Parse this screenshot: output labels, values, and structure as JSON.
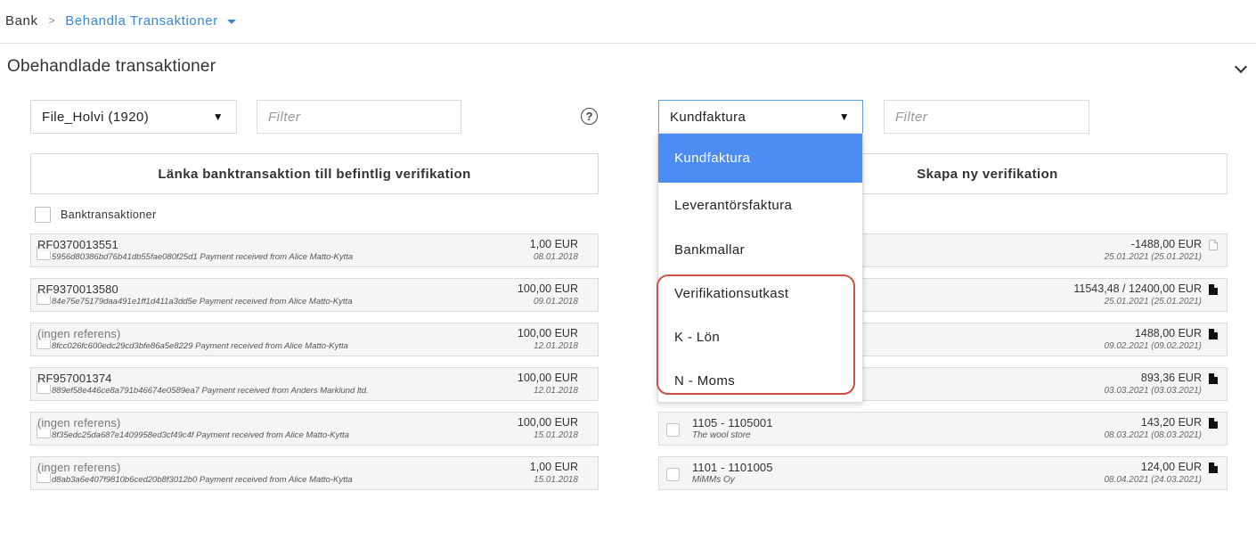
{
  "breadcrumb": {
    "root": "Bank",
    "separator": ">",
    "current": "Behandla Transaktioner"
  },
  "section": {
    "title": "Obehandlade transaktioner"
  },
  "left": {
    "select_value": "File_Holvi (1920)",
    "filter_placeholder": "Filter",
    "button_label": "Länka banktransaktion till befintlig verifikation",
    "header_label": "Banktransaktioner",
    "rows": [
      {
        "ref": "RF0370013551",
        "desc": "5956d80386bd76b41db55fae080f25d1 Payment received from Alice Matto-Kytta",
        "amount": "1,00 EUR",
        "date": "08.01.2018"
      },
      {
        "ref": "RF9370013580",
        "desc": "84e75e75179daa491e1ff1d411a3dd5e Payment received from Alice Matto-Kytta",
        "amount": "100,00 EUR",
        "date": "09.01.2018"
      },
      {
        "ref": "(ingen referens)",
        "desc": "8fcc026fc600edc29cd3bfe86a5e8229 Payment received from Alice Matto-Kytta",
        "amount": "100,00 EUR",
        "date": "12.01.2018"
      },
      {
        "ref": "RF957001374",
        "desc": "889ef58e446ce8a791b46674e0589ea7 Payment received from Anders Marklund ltd.",
        "amount": "100,00 EUR",
        "date": "12.01.2018"
      },
      {
        "ref": "(ingen referens)",
        "desc": "8f35edc25da687e1409958ed3cf49c4f Payment received from Alice Matto-Kytta",
        "amount": "100,00 EUR",
        "date": "15.01.2018"
      },
      {
        "ref": "(ingen referens)",
        "desc": "d8ab3a6e407f9810b6ced20b8f3012b0 Payment received from Alice Matto-Kytta",
        "amount": "1,00 EUR",
        "date": "15.01.2018"
      }
    ]
  },
  "right": {
    "select_value": "Kundfaktura",
    "filter_placeholder": "Filter",
    "button_label": "Skapa ny verifikation",
    "rows": [
      {
        "ref": "",
        "desc": "",
        "amount": "-1488,00 EUR",
        "date": "25.01.2021 (25.01.2021)",
        "icon": "document-outline-icon"
      },
      {
        "ref": "",
        "desc": "",
        "amount": "11543,48 / 12400,00 EUR",
        "date": "25.01.2021 (25.01.2021)",
        "icon": "document-filled-icon"
      },
      {
        "ref": "",
        "desc": "",
        "amount": "1488,00 EUR",
        "date": "09.02.2021 (09.02.2021)",
        "icon": "document-filled-icon"
      },
      {
        "ref": "",
        "desc": "",
        "amount": "893,36 EUR",
        "date": "03.03.2021 (03.03.2021)",
        "icon": "document-filled-icon"
      },
      {
        "ref": "1105 - 1105001",
        "desc": "The wool store",
        "amount": "143,20 EUR",
        "date": "08.03.2021 (08.03.2021)",
        "icon": "document-filled-icon"
      },
      {
        "ref": "1101 - 1101005",
        "desc": "MiMMs Oy",
        "amount": "124,00 EUR",
        "date": "08.04.2021 (24.03.2021)",
        "icon": "document-filled-icon"
      }
    ]
  },
  "dropdown": {
    "items": [
      "Kundfaktura",
      "Leverantörsfaktura",
      "Bankmallar",
      "Verifikationsutkast",
      "K - Lön",
      "N - Moms"
    ],
    "selected": "Kundfaktura"
  },
  "colors": {
    "accent": "#3a86d6",
    "dropdown_active": "#4b8df2",
    "highlight": "#d24f45"
  }
}
